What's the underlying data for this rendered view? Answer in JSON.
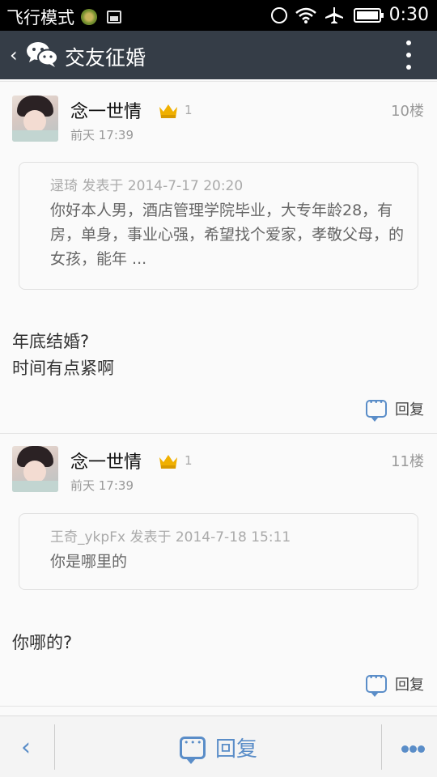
{
  "status_bar": {
    "mode_label": "飞行模式",
    "time": "0:30",
    "icons": [
      "pinwheel-icon",
      "image-icon",
      "alarm-icon",
      "wifi-icon",
      "airplane-icon",
      "battery-icon"
    ]
  },
  "header": {
    "back_icon": "chevron-left-icon",
    "app_icon": "wechat-icon",
    "title": "交友征婚",
    "menu_icon": "more-vertical-icon"
  },
  "posts": [
    {
      "username": "念一世情",
      "level": "1",
      "floor": "10楼",
      "time": "前天 17:39",
      "quote_head": "逯琦 发表于 2014-7-17 20:20",
      "quote_body": "你好本人男，酒店管理学院毕业，大专年龄28，有房，单身，事业心强，希望找个爱家，孝敬父母，的女孩，能年 ...",
      "content": "年底结婚?\n时间有点紧啊",
      "reply_label": "回复"
    },
    {
      "username": "念一世情",
      "level": "1",
      "floor": "11楼",
      "time": "前天 17:39",
      "quote_head": "王奇_ykpFx 发表于 2014-7-18 15:11",
      "quote_body": "你是哪里的",
      "content": "你哪的?",
      "reply_label": "回复"
    }
  ],
  "bottom_bar": {
    "back_icon": "chevron-left-icon",
    "reply_label": "回复",
    "more_icon": "more-horizontal-icon"
  },
  "colors": {
    "accent": "#5a8dc8",
    "header_bg": "#353d47",
    "crown": "#f0b000"
  }
}
